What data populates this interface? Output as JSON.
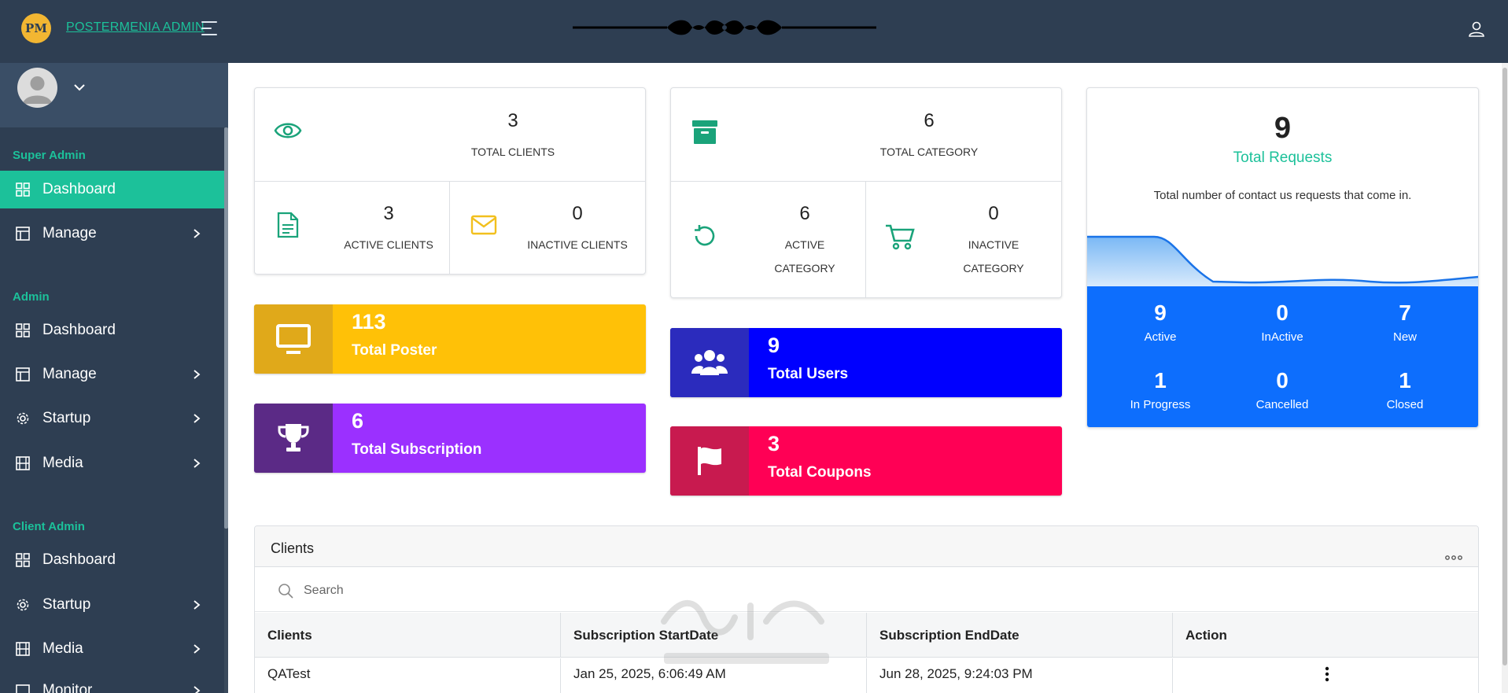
{
  "header": {
    "logo_text": "PM",
    "brand": "POSTERMENIA ADMIN"
  },
  "sidebar": {
    "sections": [
      {
        "title": "Super Admin"
      },
      {
        "title": "Admin"
      },
      {
        "title": "Client Admin"
      }
    ],
    "items": [
      {
        "label": "Dashboard"
      },
      {
        "label": "Manage"
      },
      {
        "label": "Dashboard"
      },
      {
        "label": "Manage"
      },
      {
        "label": "Startup"
      },
      {
        "label": "Media"
      },
      {
        "label": "Dashboard"
      },
      {
        "label": "Startup"
      },
      {
        "label": "Media"
      },
      {
        "label": "Monitor"
      }
    ]
  },
  "clients_card": {
    "total": {
      "value": "3",
      "label": "TOTAL CLIENTS"
    },
    "active": {
      "value": "3",
      "label": "ACTIVE CLIENTS"
    },
    "inactive": {
      "value": "0",
      "label": "INACTIVE CLIENTS"
    }
  },
  "category_card": {
    "total": {
      "value": "6",
      "label": "TOTAL CATEGORY"
    },
    "active": {
      "value": "6",
      "label_1": "ACTIVE",
      "label_2": "CATEGORY"
    },
    "inactive": {
      "value": "0",
      "label_1": "INACTIVE",
      "label_2": "CATEGORY"
    }
  },
  "tiles": {
    "poster": {
      "value": "113",
      "label": "Total Poster",
      "color": "#ffc107",
      "box_color": "#e0a91a"
    },
    "subscription": {
      "value": "6",
      "label": "Total Subscription",
      "color": "#9b30ff",
      "box_color": "#5b2a86"
    },
    "users": {
      "value": "9",
      "label": "Total Users",
      "color": "#0000ff",
      "box_color": "#2b2bbd"
    },
    "coupons": {
      "value": "3",
      "label": "Total Coupons",
      "color": "#ff0055",
      "box_color": "#c81a4f"
    }
  },
  "requests": {
    "value": "9",
    "title": "Total Requests",
    "description": "Total number of contact us requests that come in.",
    "stats": [
      {
        "value": "9",
        "label": "Active"
      },
      {
        "value": "0",
        "label": "InActive"
      },
      {
        "value": "7",
        "label": "New"
      },
      {
        "value": "1",
        "label": "In Progress"
      },
      {
        "value": "0",
        "label": "Cancelled"
      },
      {
        "value": "1",
        "label": "Closed"
      }
    ]
  },
  "clients_table": {
    "title": "Clients",
    "search_placeholder": "Search",
    "columns": [
      "Clients",
      "Subscription StartDate",
      "Subscription EndDate",
      "Action"
    ],
    "rows": [
      {
        "client": "QATest",
        "start": "Jan 25, 2025, 6:06:49 AM",
        "end": "Jun 28, 2025, 9:24:03 PM"
      }
    ]
  },
  "colors": {
    "accent": "#1cc19a",
    "nav_bg": "#2e3e52",
    "requests_blue": "#0d6efd"
  }
}
